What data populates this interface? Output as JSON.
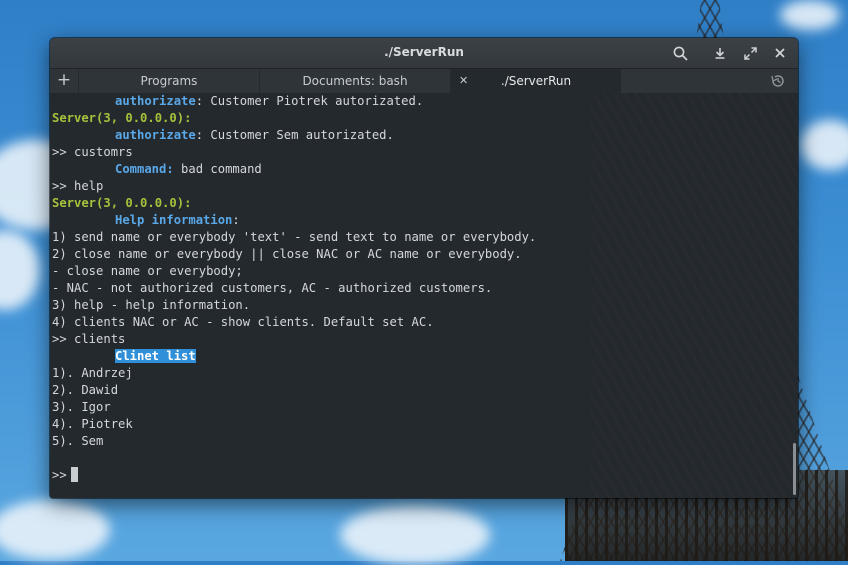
{
  "window": {
    "title": "./ServerRun"
  },
  "tabs": {
    "add_label": "+",
    "items": [
      {
        "label": "Programs"
      },
      {
        "label": "Documents: bash"
      },
      {
        "label": "./ServerRun"
      }
    ],
    "close_label": "✕"
  },
  "terminal": {
    "lines": [
      {
        "indent": true,
        "key": "authorizate",
        "rest": ": Customer Piotrek autorizated."
      },
      {
        "server": "Server(3, 0.0.0.0):"
      },
      {
        "indent": true,
        "key": "authorizate",
        "rest": ": Customer Sem autorizated."
      },
      {
        "text": ">> customrs"
      },
      {
        "indent": true,
        "key": "Command:",
        "rest": " bad command"
      },
      {
        "text": ">> help"
      },
      {
        "server": "Server(3, 0.0.0.0):"
      },
      {
        "indent": true,
        "key": "Help information",
        "rest": ":"
      },
      {
        "text": "1) send name or everybody 'text' - send text to name or everybody."
      },
      {
        "text": "2) close name or everybody || close NAC or AC name or everybody."
      },
      {
        "text": "- close name or everybody;"
      },
      {
        "text": "- NAC - not authorized customers, AC - authorized customers."
      },
      {
        "text": "3) help - help information."
      },
      {
        "text": "4) clients NAC or AC - show clients. Default set AC."
      },
      {
        "text": ">> clients"
      },
      {
        "indent": true,
        "highlight": "Clinet list"
      },
      {
        "text": "1). Andrzej"
      },
      {
        "text": "2). Dawid"
      },
      {
        "text": "3). Igor"
      },
      {
        "text": "4). Piotrek"
      },
      {
        "text": "5). Sem"
      },
      {
        "text": ""
      },
      {
        "text": ">>",
        "cursor": true
      }
    ]
  },
  "colors": {
    "server": "#a6c23b",
    "keyword": "#5aa8e8",
    "highlight_bg": "#2f8fd8",
    "background": "#24292e"
  },
  "icons": [
    "search-icon",
    "download-icon",
    "maximize-icon",
    "close-icon",
    "history-icon"
  ]
}
